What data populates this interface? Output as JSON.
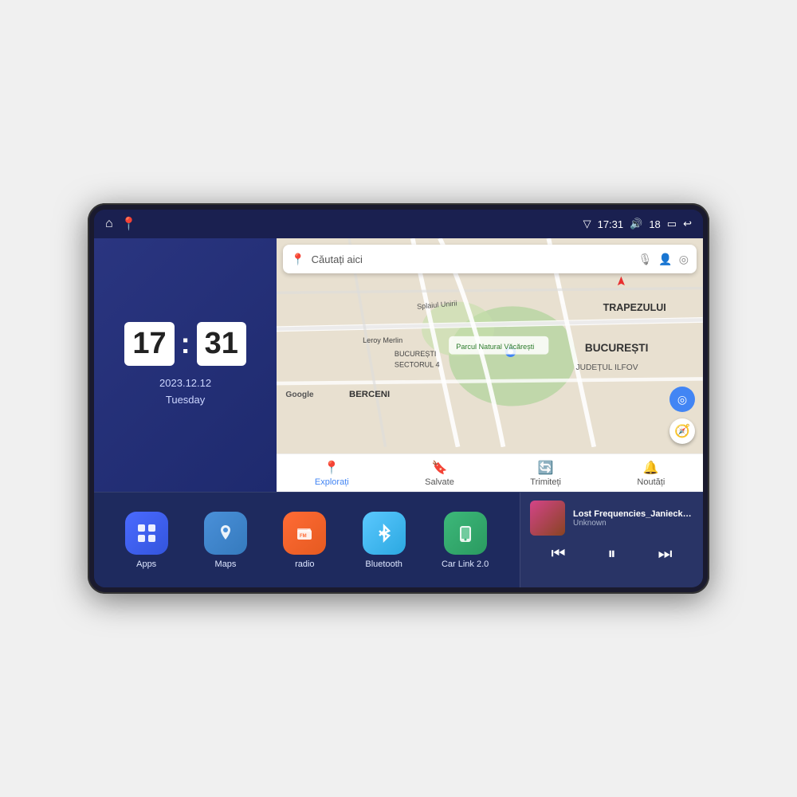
{
  "device": {
    "status_bar": {
      "left_icons": [
        "home",
        "maps-pin"
      ],
      "time": "17:31",
      "signal_icon": "▽",
      "volume_icon": "🔊",
      "volume_level": "18",
      "battery_icon": "▭",
      "back_icon": "↩"
    },
    "clock": {
      "hour": "17",
      "minute": "31",
      "date": "2023.12.12",
      "day": "Tuesday"
    },
    "map": {
      "search_placeholder": "Căutați aici",
      "location_label": "Parcul Natural Văcărești",
      "area1": "BUCUREȘTI",
      "area2": "JUDEȚUL ILFOV",
      "area3": "BERCENI",
      "area4": "BUCUREȘTI SECTORUL 4",
      "area5": "Leroy Merlin",
      "area6": "TRAPEZULUI",
      "bottom_tabs": [
        {
          "label": "Explorați",
          "icon": "📍",
          "active": true
        },
        {
          "label": "Salvate",
          "icon": "🔖",
          "active": false
        },
        {
          "label": "Trimiteți",
          "icon": "🔄",
          "active": false
        },
        {
          "label": "Noutăți",
          "icon": "🔔",
          "active": false
        }
      ]
    },
    "apps": [
      {
        "id": "apps",
        "label": "Apps",
        "icon": "⊞",
        "color_class": "app-icon-apps"
      },
      {
        "id": "maps",
        "label": "Maps",
        "icon": "🗺",
        "color_class": "app-icon-maps"
      },
      {
        "id": "radio",
        "label": "radio",
        "icon": "📻",
        "color_class": "app-icon-radio"
      },
      {
        "id": "bluetooth",
        "label": "Bluetooth",
        "icon": "✦",
        "color_class": "app-icon-bluetooth"
      },
      {
        "id": "carlink",
        "label": "Car Link 2.0",
        "icon": "📱",
        "color_class": "app-icon-carlink"
      }
    ],
    "music": {
      "title": "Lost Frequencies_Janieck Devy-...",
      "artist": "Unknown",
      "controls": {
        "prev": "⏮",
        "play_pause": "⏸",
        "next": "⏭"
      }
    }
  }
}
